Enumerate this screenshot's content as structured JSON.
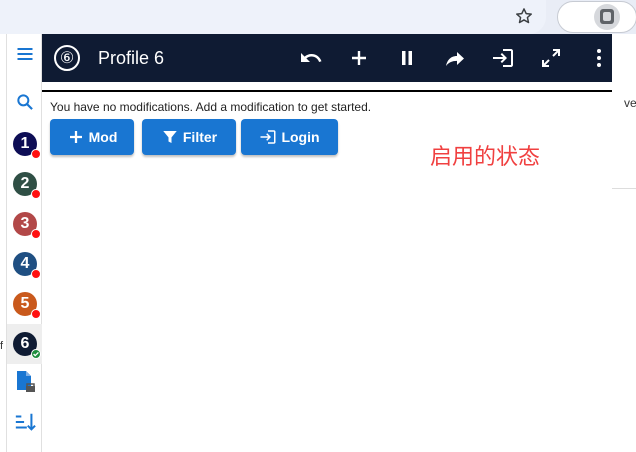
{
  "browser": {
    "star_icon": "star-icon",
    "extension_icon": "puzzle-icon"
  },
  "sidebar": {
    "menu_icon": "menu-icon",
    "search_icon": "search-icon",
    "profiles": [
      {
        "label": "1",
        "color": "#0d0d55",
        "status": "error"
      },
      {
        "label": "2",
        "color": "#2f4f45",
        "status": "error"
      },
      {
        "label": "3",
        "color": "#b24848",
        "status": "error"
      },
      {
        "label": "4",
        "color": "#1f4f82",
        "status": "error"
      },
      {
        "label": "5",
        "color": "#c9591c",
        "status": "error"
      },
      {
        "label": "6",
        "color": "#0f1b33",
        "status": "active"
      }
    ],
    "add_profile_icon": "add-file-icon",
    "sort_icon": "sort-icon"
  },
  "header": {
    "logo": "⑥",
    "title": "Profile 6",
    "background": "#0f1b33",
    "icons": [
      "undo-icon",
      "plus-icon",
      "pause-icon",
      "redo-icon",
      "login-icon",
      "fullscreen-icon",
      "more-vert-icon"
    ]
  },
  "main": {
    "message": "You have no modifications. Add a modification to get started.",
    "buttons": {
      "mod": "Mod",
      "filter": "Filter",
      "login": "Login"
    },
    "accent": "#1976d2",
    "annotation": "启用的状态",
    "annotation_color": "#f04040"
  },
  "background_fragments": {
    "right": "ve",
    "left": "f"
  }
}
